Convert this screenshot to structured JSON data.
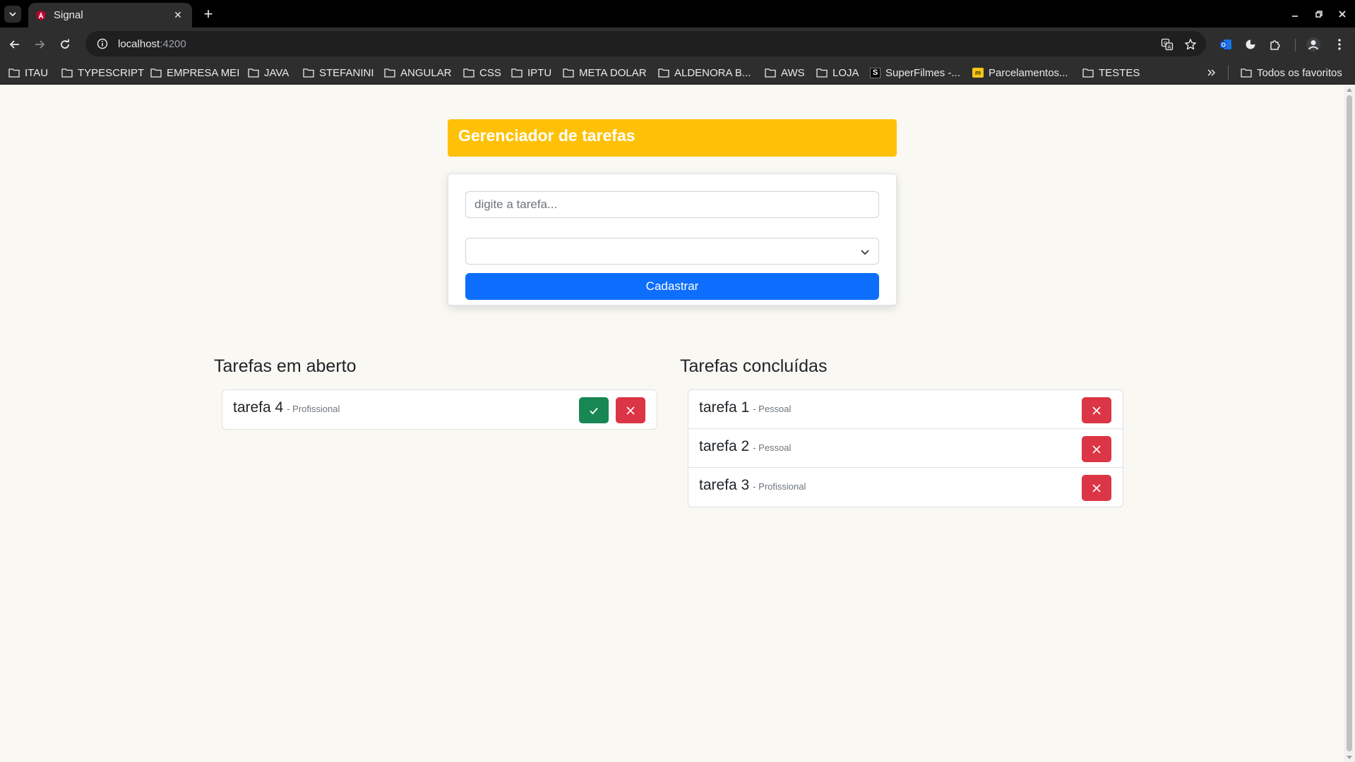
{
  "browser": {
    "tab_title": "Signal",
    "url_host": "localhost",
    "url_port": ":4200",
    "bookmarks": [
      "ITAU",
      "TYPESCRIPT",
      "EMPRESA MEI",
      "JAVA",
      "STEFANINI",
      "ANGULAR",
      "CSS",
      "IPTU",
      "META DOLAR",
      "ALDENORA B...",
      "AWS",
      "LOJA",
      "SuperFilmes -...",
      "Parcelamentos...",
      "TESTES"
    ],
    "all_bookmarks": "Todos os favoritos"
  },
  "app": {
    "title": "Gerenciador de tarefas",
    "form": {
      "task_placeholder": "digite a tarefa...",
      "task_value": "",
      "category_value": "",
      "submit_label": "Cadastrar"
    },
    "open_section": {
      "title": "Tarefas em aberto",
      "items": [
        {
          "name": "tarefa 4",
          "category": "- Profissional"
        }
      ]
    },
    "done_section": {
      "title": "Tarefas concluídas",
      "items": [
        {
          "name": "tarefa 1",
          "category": "- Pessoal"
        },
        {
          "name": "tarefa 2",
          "category": "- Pessoal"
        },
        {
          "name": "tarefa 3",
          "category": "- Profissional"
        }
      ]
    }
  },
  "colors": {
    "header": "#ffc107",
    "primary": "#0d6efd",
    "success": "#198754",
    "danger": "#dc3545",
    "page_bg": "#f9f8f2"
  }
}
